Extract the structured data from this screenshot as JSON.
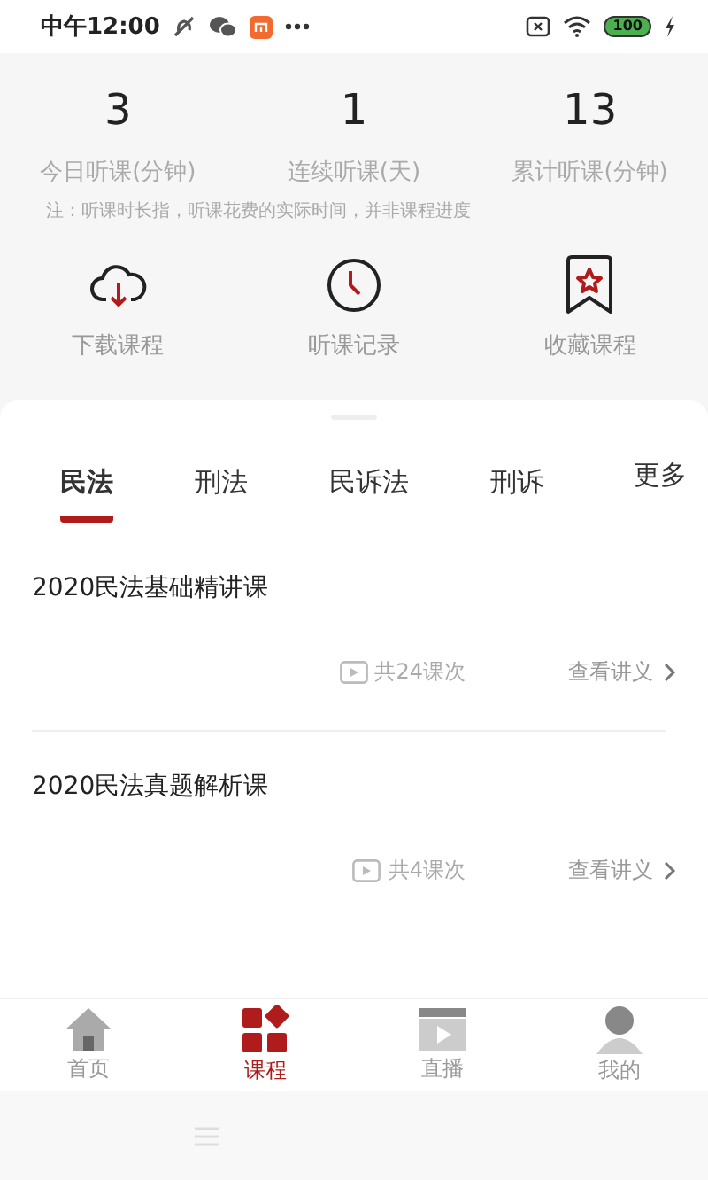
{
  "status_bar": {
    "time": "中午12:00",
    "battery": "100"
  },
  "stats": [
    {
      "value": "3",
      "label": "今日听课(分钟)"
    },
    {
      "value": "1",
      "label": "连续听课(天)"
    },
    {
      "value": "13",
      "label": "累计听课(分钟)"
    }
  ],
  "note": "注：听课时长指，听课花费的实际时间，并非课程进度",
  "shortcuts": [
    {
      "kind": "download",
      "label": "下载课程"
    },
    {
      "kind": "history",
      "label": "听课记录"
    },
    {
      "kind": "favorite",
      "label": "收藏课程"
    }
  ],
  "tabs": [
    {
      "label": "民法",
      "selected": true
    },
    {
      "label": "刑法",
      "selected": false
    },
    {
      "label": "民诉法",
      "selected": false
    },
    {
      "label": "刑诉",
      "selected": false
    }
  ],
  "more": "更多",
  "courses": [
    {
      "title": "2020民法基础精讲课",
      "lessons": "共24课次",
      "link": "查看讲义"
    },
    {
      "title": "2020民法真题解析课",
      "lessons": "共4课次",
      "link": "查看讲义"
    }
  ],
  "nav": [
    {
      "kind": "home",
      "label": "首页",
      "selected": false
    },
    {
      "kind": "course",
      "label": "课程",
      "selected": true
    },
    {
      "kind": "live",
      "label": "直播",
      "selected": false
    },
    {
      "kind": "me",
      "label": "我的",
      "selected": false
    }
  ]
}
